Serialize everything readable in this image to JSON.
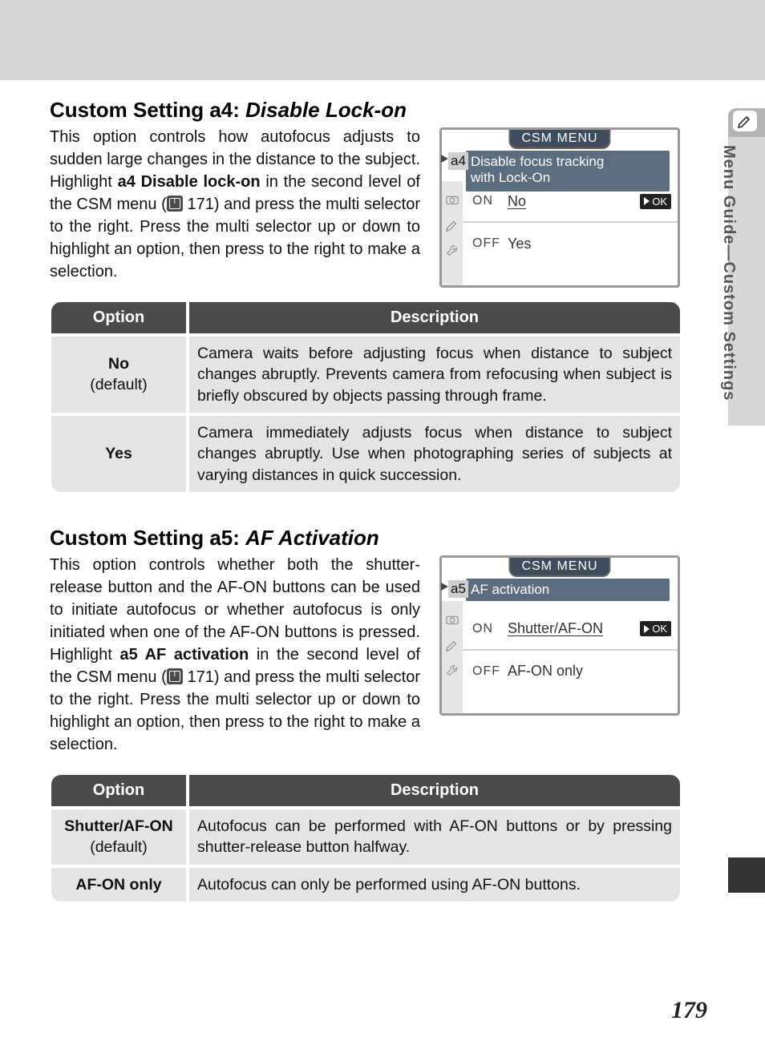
{
  "side_tab": {
    "label": "Menu Guide—Custom Settings"
  },
  "page_number": "179",
  "section_a4": {
    "heading_prefix": "Custom Setting a4: ",
    "heading_name": "Disable Lock-on",
    "body_pre": "This option controls how autofocus adjusts to sudden large changes in the distance to the subject. Highlight ",
    "body_bold": "a4 Disable lock-on",
    "body_mid": " in the second level of the CSM menu (",
    "body_pageref": " 171) and press the multi selector to the right. Press the multi selector up or down to highlight an option, then press to the right to make a selection.",
    "lcd": {
      "title": "CSM MENU",
      "code": "a4",
      "subtitle": "Disable focus tracking\nwith Lock-On",
      "rows": [
        {
          "flag": "ON",
          "value": "No",
          "ok": true
        },
        {
          "flag": "OFF",
          "value": "Yes",
          "ok": false
        }
      ],
      "ok_label": "OK"
    },
    "table": {
      "head_option": "Option",
      "head_desc": "Description",
      "rows": [
        {
          "option_label": "No",
          "option_sub": "(default)",
          "desc": "Camera waits before adjusting focus when distance to subject changes abruptly. Prevents camera from refocusing when subject is briefly obscured by objects passing through frame."
        },
        {
          "option_label": "Yes",
          "option_sub": "",
          "desc": "Camera immediately adjusts focus when distance to subject changes abruptly. Use when photographing series of subjects at varying distances in quick succession."
        }
      ]
    }
  },
  "section_a5": {
    "heading_prefix": "Custom Setting a5: ",
    "heading_name": "AF Activation",
    "body_pre": "This option controls whether both the shutter-release button and the AF-ON buttons can be used to initiate autofocus or whether autofocus is only initiated when one of the AF-ON buttons is pressed. Highlight ",
    "body_bold": "a5 AF activation",
    "body_mid": " in the second level of the CSM menu (",
    "body_pageref": " 171) and press the multi selector to the right. Press the multi selector up or down to highlight an option, then press to the right to make a selection.",
    "lcd": {
      "title": "CSM MENU",
      "code": "a5",
      "subtitle": "AF activation",
      "rows": [
        {
          "flag": "ON",
          "value": "Shutter/AF-ON",
          "ok": true
        },
        {
          "flag": "OFF",
          "value": "AF-ON only",
          "ok": false
        }
      ],
      "ok_label": "OK"
    },
    "table": {
      "head_option": "Option",
      "head_desc": "Description",
      "rows": [
        {
          "option_label": "Shutter/AF-ON",
          "option_sub": "(default)",
          "desc": "Autofocus can be performed with AF-ON buttons or by pressing shutter-release button halfway."
        },
        {
          "option_label": "AF-ON only",
          "option_sub": "",
          "desc": "Autofocus can only be performed using AF-ON buttons."
        }
      ]
    }
  }
}
